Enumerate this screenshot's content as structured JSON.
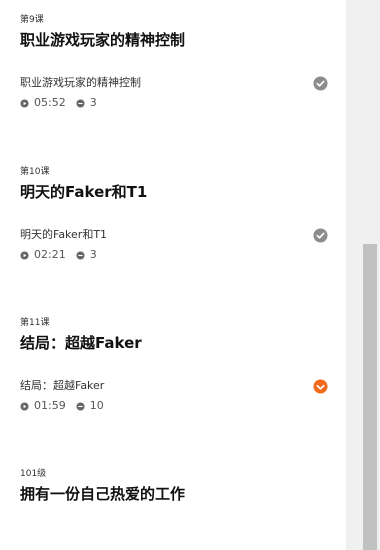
{
  "lessons": [
    {
      "number": "第9课",
      "title": "职业游戏玩家的精神控制",
      "item": {
        "title": "职业游戏玩家的精神控制",
        "duration": "05:52",
        "comments": "3",
        "status": "completed"
      }
    },
    {
      "number": "第10课",
      "title": "明天的Faker和T1",
      "item": {
        "title": "明天的Faker和T1",
        "duration": "02:21",
        "comments": "3",
        "status": "completed"
      }
    },
    {
      "number": "第11课",
      "title": "结局：超越Faker",
      "item": {
        "title": "结局：超越Faker",
        "duration": "01:59",
        "comments": "10",
        "status": "current"
      }
    },
    {
      "number": "101级",
      "title": "拥有一份自己热爱的工作"
    }
  ],
  "colors": {
    "check_completed": "#8c8c8c",
    "check_current": "#f26b1d",
    "scroll_track": "#f0f0f0",
    "scroll_thumb": "#c1c1c1"
  },
  "icons": {
    "duration": "play-circle-icon",
    "comments": "comment-icon",
    "status": "check-circle-icon"
  }
}
